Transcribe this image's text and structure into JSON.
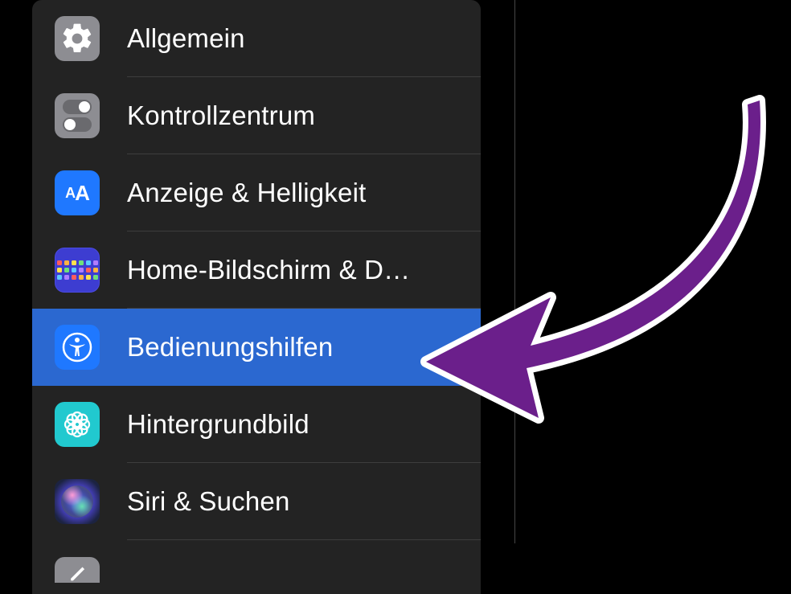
{
  "menu": {
    "items": [
      {
        "label": "Allgemein",
        "icon": "gear-icon",
        "selected": false
      },
      {
        "label": "Kontrollzentrum",
        "icon": "control-center-icon",
        "selected": false
      },
      {
        "label": "Anzeige & Helligkeit",
        "icon": "display-icon",
        "selected": false
      },
      {
        "label": "Home-Bildschirm & D…",
        "icon": "home-screen-icon",
        "selected": false
      },
      {
        "label": "Bedienungshilfen",
        "icon": "accessibility-icon",
        "selected": true
      },
      {
        "label": "Hintergrundbild",
        "icon": "wallpaper-icon",
        "selected": false
      },
      {
        "label": "Siri & Suchen",
        "icon": "siri-icon",
        "selected": false
      }
    ]
  },
  "annotation": {
    "type": "arrow",
    "color": "#6b1f8b",
    "outline": "#ffffff",
    "target": "Bedienungshilfen"
  }
}
